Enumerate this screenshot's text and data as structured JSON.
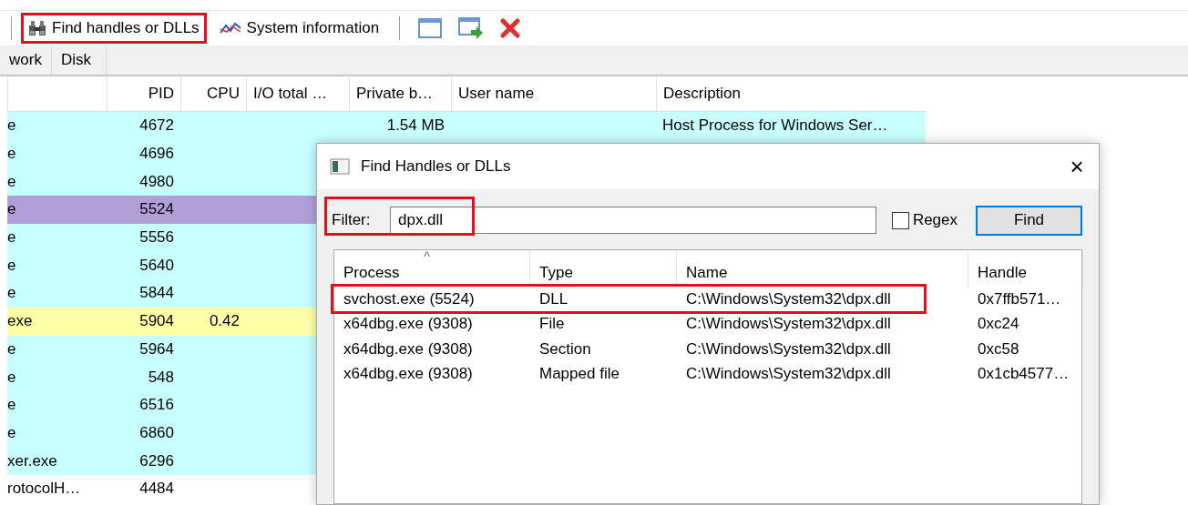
{
  "toolbar": {
    "items": [
      {
        "kind": "button",
        "label": "Find handles or DLLs",
        "highlighted": true
      },
      {
        "kind": "button",
        "label": "System information",
        "highlighted": false
      },
      {
        "kind": "separator"
      },
      {
        "kind": "icon"
      },
      {
        "kind": "icon"
      },
      {
        "kind": "icon"
      }
    ]
  },
  "tabs": [
    {
      "label": "work",
      "selected": false
    },
    {
      "label": "Disk",
      "selected": false
    }
  ],
  "process_table": {
    "columns": [
      "PID",
      "CPU",
      "I/O total …",
      "Private b…",
      "User name",
      "Description"
    ],
    "rows": [
      {
        "name": "e",
        "pid": "4672",
        "private_bytes": "1.54 MB",
        "description": "Host Process for Windows Ser…",
        "color": "#c8ffff"
      },
      {
        "name": "e",
        "pid": "4696",
        "color": "#c8ffff"
      },
      {
        "name": "e",
        "pid": "4980",
        "color": "#c8ffff"
      },
      {
        "name": "e",
        "pid": "5524",
        "color": "#b0a0d8"
      },
      {
        "name": "e",
        "pid": "5556",
        "color": "#c8ffff"
      },
      {
        "name": "e",
        "pid": "5640",
        "color": "#c8ffff"
      },
      {
        "name": "e",
        "pid": "5844",
        "color": "#c8ffff"
      },
      {
        "name": "exe",
        "pid": "5904",
        "cpu": "0.42",
        "color": "#ffffa8"
      },
      {
        "name": "e",
        "pid": "5964",
        "color": "#c8ffff"
      },
      {
        "name": "e",
        "pid": "548",
        "color": "#c8ffff"
      },
      {
        "name": "e",
        "pid": "6516",
        "color": "#c8ffff"
      },
      {
        "name": "e",
        "pid": "6860",
        "color": "#c8ffff"
      },
      {
        "name": "xer.exe",
        "pid": "6296",
        "color": "#c8ffff"
      },
      {
        "name": "rotocolH…",
        "pid": "4484",
        "color": "#ffffff"
      }
    ]
  },
  "dialog": {
    "title": "Find Handles or DLLs",
    "close": "×",
    "filter": {
      "label": "Filter:",
      "value": "dpx.dll",
      "highlighted": true
    },
    "regex": {
      "label": "Regex",
      "checked": false
    },
    "find_button": "Find",
    "sort_mark": "^",
    "columns": [
      "Process",
      "Type",
      "Name",
      "Handle"
    ],
    "rows": [
      {
        "process": "svchost.exe (5524)",
        "type": "DLL",
        "name": "C:\\Windows\\System32\\dpx.dll",
        "handle": "0x7ffb571…",
        "highlighted": true
      },
      {
        "process": "x64dbg.exe (9308)",
        "type": "File",
        "name": "C:\\Windows\\System32\\dpx.dll",
        "handle": "0xc24",
        "highlighted": false
      },
      {
        "process": "x64dbg.exe (9308)",
        "type": "Section",
        "name": "C:\\Windows\\System32\\dpx.dll",
        "handle": "0xc58",
        "highlighted": false
      },
      {
        "process": "x64dbg.exe (9308)",
        "type": "Mapped file",
        "name": "C:\\Windows\\System32\\dpx.dll",
        "handle": "0x1cb4577…",
        "highlighted": false
      }
    ]
  }
}
